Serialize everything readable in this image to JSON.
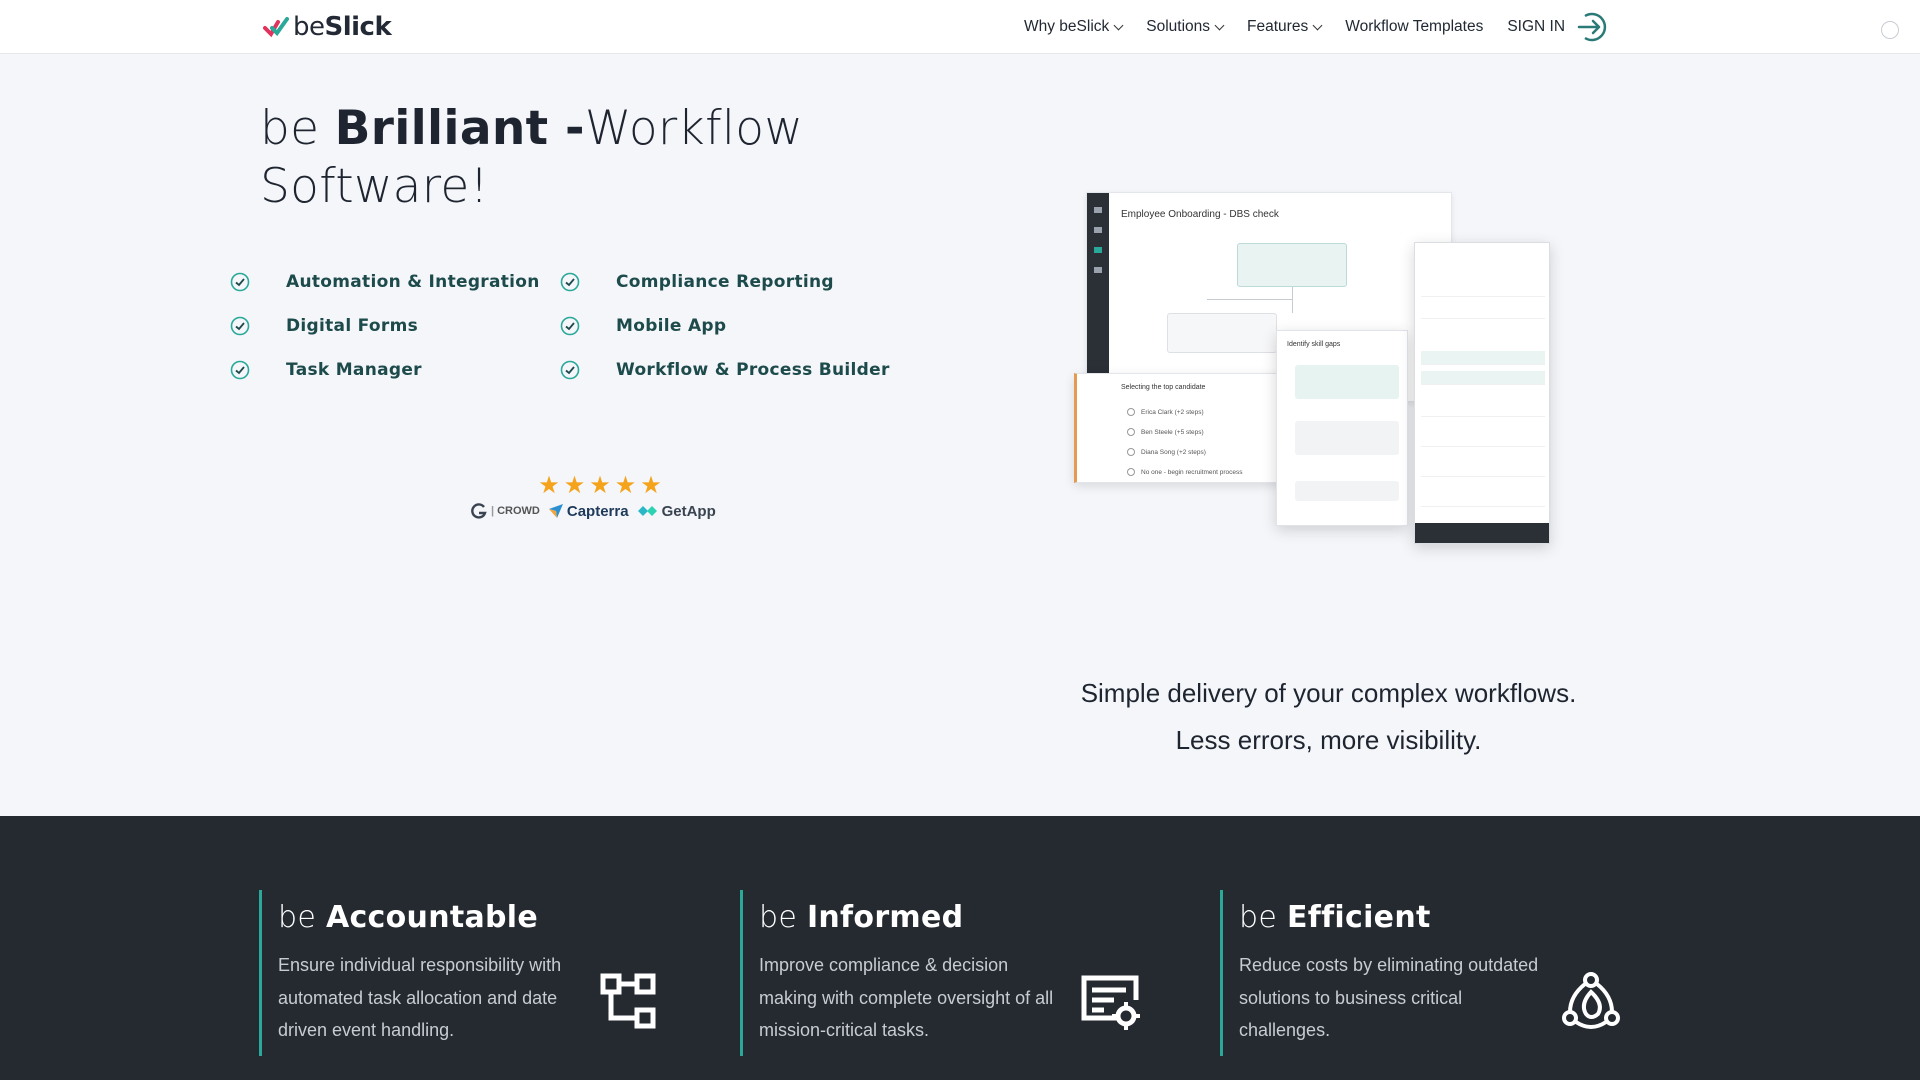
{
  "nav": {
    "brand_prefix": "be",
    "brand_bold": "Slick",
    "links": [
      {
        "label": "Why beSlick",
        "has_dropdown": true
      },
      {
        "label": "Solutions",
        "has_dropdown": true
      },
      {
        "label": "Features",
        "has_dropdown": true
      },
      {
        "label": "Workflow Templates",
        "has_dropdown": false
      }
    ],
    "signin_label": "SIGN IN"
  },
  "hero": {
    "title_prefix": "be ",
    "title_bold": "Brilliant -",
    "title_rest": "Workflow Software!",
    "features": [
      "Automation & Integration",
      "Compliance Reporting",
      "Digital Forms",
      "Mobile App",
      "Task Manager",
      "Workflow & Process Builder"
    ],
    "rating_stars": 5,
    "review_sites": [
      "CROWD",
      "Capterra",
      "GetApp"
    ]
  },
  "mockup": {
    "window_title": "Employee Onboarding - DBS check",
    "list_header": "Selecting the top candidate",
    "list_items": [
      "Erica Clark (+2 steps)",
      "Ben Steele (+5 steps)",
      "Diana Song (+2 steps)",
      "No one - begin recruitment process"
    ],
    "chat_header": "Identify skill gaps"
  },
  "tagline": {
    "line1": "Simple delivery of your complex workflows.",
    "line2": "Less errors, more visibility."
  },
  "cards": [
    {
      "prefix": "be ",
      "bold": "Accountable",
      "text": "Ensure individual responsibility with automated task allocation and date driven event handling.",
      "icon": "workflow-tree-icon"
    },
    {
      "prefix": "be ",
      "bold": "Informed",
      "text": "Improve compliance & decision making with complete oversight of all mission-critical tasks.",
      "icon": "report-settings-icon"
    },
    {
      "prefix": "be ",
      "bold": "Efficient",
      "text": "Reduce costs by eliminating outdated solutions to business critical challenges.",
      "icon": "recycle-network-icon"
    }
  ],
  "colors": {
    "accent": "#2aa89a",
    "feature_text": "#1d4a4a",
    "dark_band": "#252a31",
    "star": "#f4a31b"
  }
}
